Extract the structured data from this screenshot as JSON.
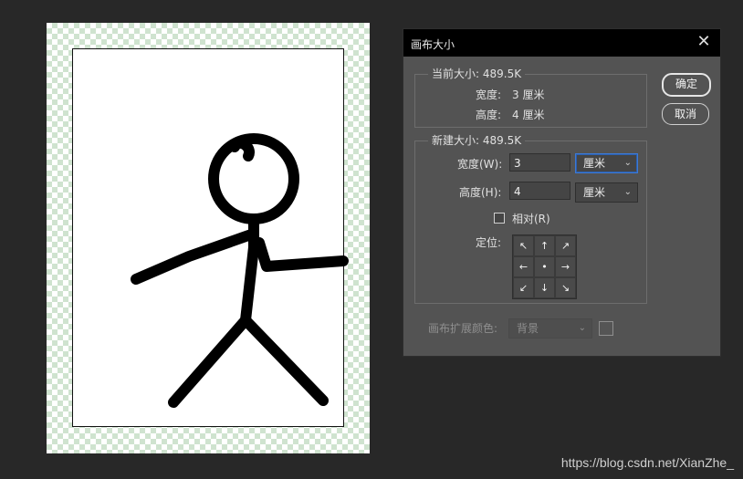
{
  "dialog": {
    "title": "画布大小",
    "close_icon": "close-icon",
    "current_size": {
      "legend": "当前大小: 489.5K",
      "width_label": "宽度:",
      "width_value": "3 厘米",
      "height_label": "高度:",
      "height_value": "4 厘米"
    },
    "new_size": {
      "legend": "新建大小: 489.5K",
      "width_label": "宽度(W):",
      "width_value": "3",
      "width_unit": "厘米",
      "height_label": "高度(H):",
      "height_value": "4",
      "height_unit": "厘米",
      "relative_label": "相对(R)",
      "anchor_label": "定位:"
    },
    "extension_color": {
      "label": "画布扩展颜色:",
      "value": "背景"
    },
    "buttons": {
      "ok": "确定",
      "cancel": "取消"
    }
  },
  "watermark": "https://blog.csdn.net/XianZhe_",
  "colors": {
    "app_bg": "#282828",
    "dialog_bg": "#535353",
    "titlebar_bg": "#000000",
    "focus_blue": "#3d7ad6"
  }
}
